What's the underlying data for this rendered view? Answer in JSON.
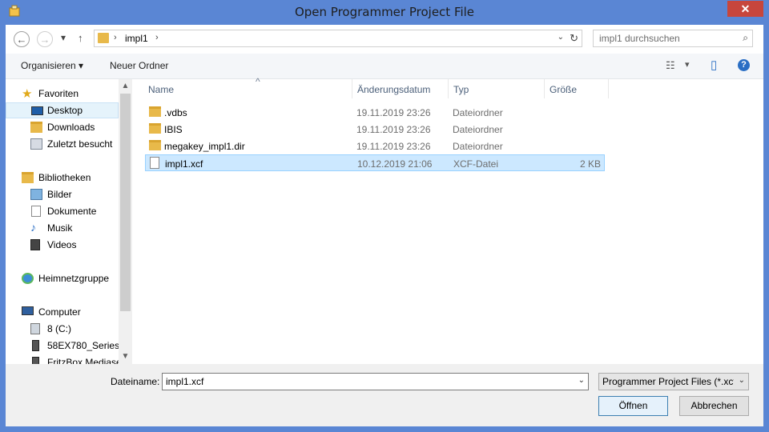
{
  "window": {
    "title": "Open Programmer Project File",
    "close_glyph": "✕"
  },
  "nav": {
    "back_glyph": "←",
    "forward_glyph": "→",
    "recent_glyph": "▾",
    "up_glyph": "↑",
    "breadcrumb_sep": "›",
    "breadcrumb": "impl1",
    "address_dropdown_glyph": "⌄",
    "refresh_glyph": "↻",
    "search_placeholder": "impl1 durchsuchen",
    "search_glyph": "⌕"
  },
  "toolbar": {
    "organize": "Organisieren ▾",
    "new_folder": "Neuer Ordner",
    "views_glyph": "☷",
    "views_dd_glyph": "▾",
    "preview_glyph": "▯",
    "help_glyph": "?"
  },
  "sidebar": {
    "scroll_up": "▲",
    "scroll_down": "▼",
    "items": [
      {
        "label": "Favoriten",
        "icon": "star-icon"
      },
      {
        "label": "Desktop",
        "icon": "desktop-icon",
        "selected": true
      },
      {
        "label": "Downloads",
        "icon": "downloads-icon"
      },
      {
        "label": "Zuletzt besucht",
        "icon": "recent-places-icon"
      },
      {
        "label": "Bibliotheken",
        "icon": "libraries-icon"
      },
      {
        "label": "Bilder",
        "icon": "pictures-icon"
      },
      {
        "label": "Dokumente",
        "icon": "documents-icon"
      },
      {
        "label": "Musik",
        "icon": "music-icon"
      },
      {
        "label": "Videos",
        "icon": "videos-icon"
      },
      {
        "label": "Heimnetzgruppe",
        "icon": "homegroup-icon"
      },
      {
        "label": "Computer",
        "icon": "computer-icon"
      },
      {
        "label": "8 (C:)",
        "icon": "drive-icon"
      },
      {
        "label": "58EX780_Series",
        "icon": "media-device-icon"
      },
      {
        "label": "FritzBox Mediase",
        "icon": "media-device-icon"
      }
    ]
  },
  "filelist": {
    "columns": [
      "Name",
      "Änderungsdatum",
      "Typ",
      "Größe"
    ],
    "sort_glyph": "^",
    "rows": [
      {
        "name": ".vdbs",
        "date": "19.11.2019 23:26",
        "type": "Dateiordner",
        "size": "",
        "kind": "folder"
      },
      {
        "name": "IBIS",
        "date": "19.11.2019 23:26",
        "type": "Dateiordner",
        "size": "",
        "kind": "folder"
      },
      {
        "name": "megakey_impl1.dir",
        "date": "19.11.2019 23:26",
        "type": "Dateiordner",
        "size": "",
        "kind": "folder"
      },
      {
        "name": "impl1.xcf",
        "date": "10.12.2019 21:06",
        "type": "XCF-Datei",
        "size": "2 KB",
        "kind": "file",
        "selected": true
      }
    ]
  },
  "bottom": {
    "filename_label": "Dateiname:",
    "filename_value": "impl1.xcf",
    "dropdown_glyph": "⌄",
    "filter_value": "Programmer Project Files (*.xcf)",
    "open_button": "Öffnen",
    "cancel_button": "Abbrechen"
  },
  "colors": {
    "window_frame": "#5a86d4",
    "close_button": "#c7463c",
    "selection": "#cce8ff",
    "folder": "#e8b94a"
  }
}
